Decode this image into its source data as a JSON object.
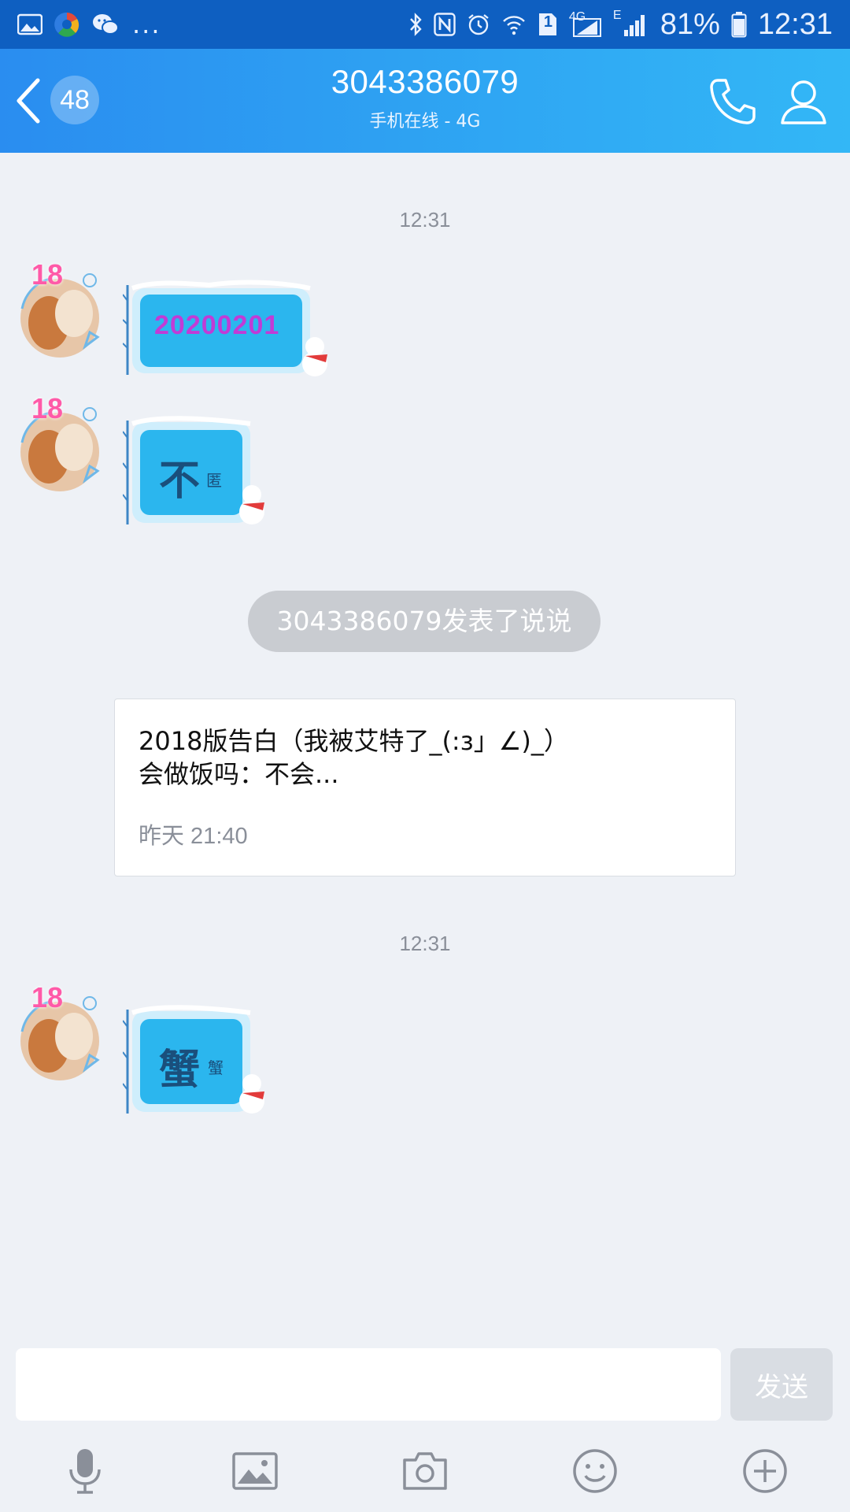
{
  "status_bar": {
    "battery": "81%",
    "time": "12:31",
    "signal_label_4g": "4G",
    "signal_label_e": "E",
    "sim_slot": "1",
    "more": "...",
    "icons": [
      "gallery-icon",
      "browser-icon",
      "wechat-icon",
      "bluetooth-icon",
      "nfc-icon",
      "alarm-icon",
      "wifi-icon",
      "sim-icon",
      "signal-icon",
      "battery-icon"
    ]
  },
  "header": {
    "unread_count": "48",
    "title": "3043386079",
    "subtitle": "手机在线 - 4G",
    "icons": [
      "back-icon",
      "phone-icon",
      "profile-icon"
    ]
  },
  "messages": {
    "timestamp_1": "12:31",
    "sticker_1_text": "20200201",
    "sticker_2_text": "不",
    "sticker_2_small": "匿",
    "notice": "3043386079发表了说说",
    "post": {
      "line1": "2018版告白（我被艾特了_(:з」∠)_）",
      "line2": "会做饭吗：不会...",
      "time": "昨天 21:40"
    },
    "timestamp_2": "12:31",
    "sticker_3_text": "蟹",
    "sticker_3_small": "蟹",
    "avatar_badge": "18"
  },
  "composer": {
    "input_value": "",
    "send_label": "发送",
    "toolbar_icons": [
      "microphone-icon",
      "image-icon",
      "camera-icon",
      "emoji-icon",
      "plus-icon"
    ]
  },
  "colors": {
    "status_bar": "#0e5fc1",
    "header_gradient_start": "#2a8df0",
    "header_gradient_end": "#33b7f6",
    "chat_background": "#eef1f6",
    "sticker_fill": "#2bb6ee",
    "sticker_text_purple": "#c13bd6",
    "sticker_text_dark": "#1a4f7c",
    "toolbar_icon": "#8a8f99"
  }
}
